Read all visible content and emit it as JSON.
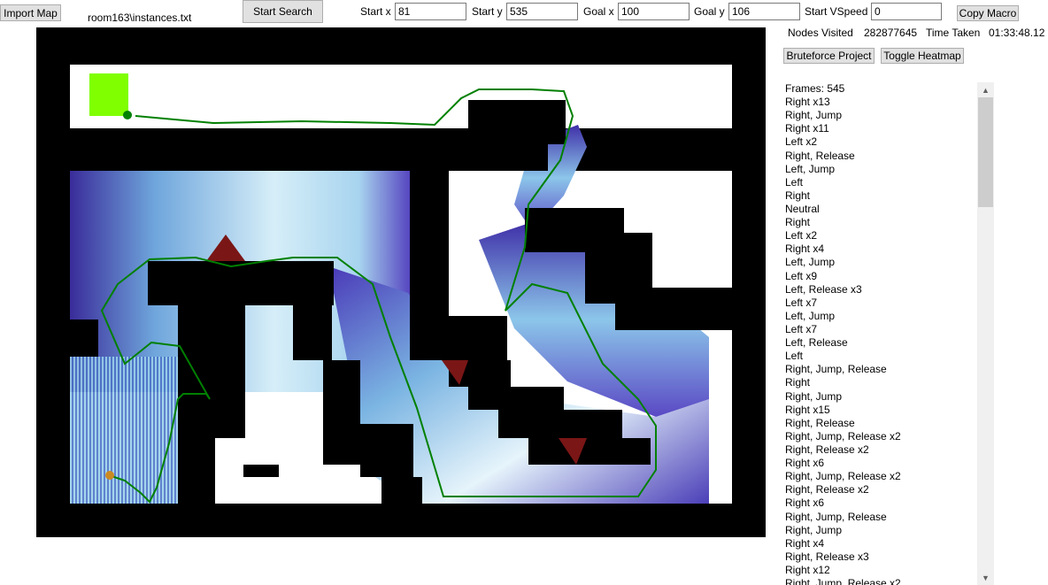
{
  "toolbar": {
    "import_label": "Import Map",
    "file_name": "room163\\instances.txt",
    "start_search_label": "Start Search",
    "start_x_label": "Start x",
    "start_x_value": "81",
    "start_y_label": "Start y",
    "start_y_value": "535",
    "goal_x_label": "Goal x",
    "goal_x_value": "100",
    "goal_y_label": "Goal y",
    "goal_y_value": "106",
    "start_vspeed_label": "Start VSpeed",
    "start_vspeed_value": "0",
    "copy_macro_label": "Copy Macro"
  },
  "stats": {
    "nodes_visited_label": "Nodes Visited",
    "nodes_visited_value": "282877645",
    "time_taken_label": "Time Taken",
    "time_taken_value": "01:33:48.12"
  },
  "actions": {
    "bruteforce_label": "Bruteforce Project",
    "heatmap_label": "Toggle Heatmap"
  },
  "macro": {
    "items": [
      "Frames: 545",
      "Right x13",
      "Right, Jump",
      "Right x11",
      "Left x2",
      "Right, Release",
      "Left, Jump",
      "Left",
      "Right",
      "Neutral",
      "Right",
      "Left x2",
      "Right x4",
      "Left, Jump",
      "Left x9",
      "Left, Release x3",
      "Left x7",
      "Left, Jump",
      "Left x7",
      "Left, Release",
      "Left",
      "Right, Jump, Release",
      "Right",
      "Right, Jump",
      "Right x15",
      "Right, Release",
      "Right, Jump, Release x2",
      "Right, Release x2",
      "Right x6",
      "Right, Jump, Release x2",
      "Right, Release x2",
      "Right x6",
      "Right, Jump, Release",
      "Right, Jump",
      "Right x4",
      "Right, Release x3",
      "Right x12",
      "Right, Jump, Release x2"
    ]
  },
  "colors": {
    "wall": "#000000",
    "goal": "#7fff00",
    "path": "#008000",
    "start_marker": "#cc8a22",
    "spike": "#7a1616",
    "heat_low": "#4b3fb8",
    "heat_high": "#e8f6fc"
  },
  "icons": {
    "scroll_up": "chevron-up-icon",
    "scroll_down": "chevron-down-icon"
  }
}
